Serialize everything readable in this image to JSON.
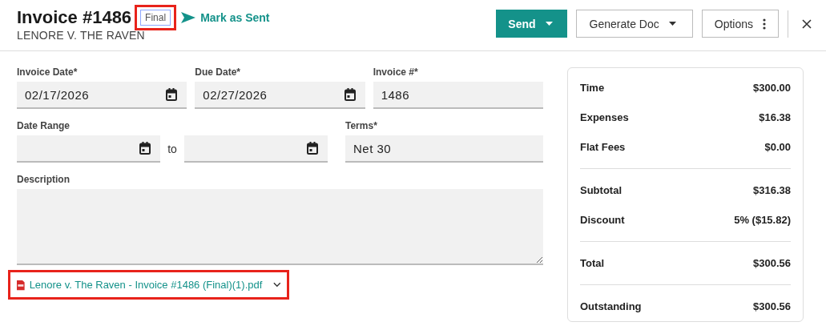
{
  "header": {
    "title": "Invoice #1486",
    "status_badge": {
      "label": "Final",
      "highlighted": true
    },
    "mark_sent": {
      "label": "Mark as Sent"
    },
    "subtitle": "LENORE V. THE RAVEN",
    "buttons": [
      {
        "label": "Send",
        "kind": "primary-dropdown"
      },
      {
        "label": "Generate Doc",
        "kind": "dropdown"
      },
      {
        "label": "Options",
        "kind": "menu"
      }
    ]
  },
  "form": {
    "rows": [
      {
        "kind": "triple",
        "fields": [
          {
            "label": "Invoice Date*",
            "kind": "date",
            "value": "02/17/2026"
          },
          {
            "label": "Due Date*",
            "kind": "date",
            "value": "02/27/2026"
          },
          {
            "label": "Invoice #*",
            "kind": "text",
            "value": "1486"
          }
        ]
      },
      {
        "kind": "range",
        "range": {
          "label": "Date Range",
          "separator": "to"
        },
        "fields": [
          {
            "label": "Terms*",
            "kind": "text",
            "value": "Net 30"
          }
        ]
      },
      {
        "kind": "full",
        "fields": [
          {
            "label": "Description",
            "kind": "textarea"
          }
        ]
      }
    ],
    "attachment": {
      "name": "Lenore v. The Raven - Invoice #1486 (Final)(1).pdf",
      "highlighted": true
    }
  },
  "summary": {
    "groups": [
      [
        {
          "label": "Time",
          "value": "$300.00"
        },
        {
          "label": "Expenses",
          "value": "$16.38"
        },
        {
          "label": "Flat Fees",
          "value": "$0.00"
        }
      ],
      [
        {
          "label": "Subtotal",
          "value": "$316.38"
        },
        {
          "label": "Discount",
          "value": "5% ($15.82)"
        }
      ],
      [
        {
          "label": "Total",
          "value": "$300.56"
        }
      ],
      [
        {
          "label": "Outstanding",
          "value": "$300.56"
        }
      ]
    ]
  }
}
